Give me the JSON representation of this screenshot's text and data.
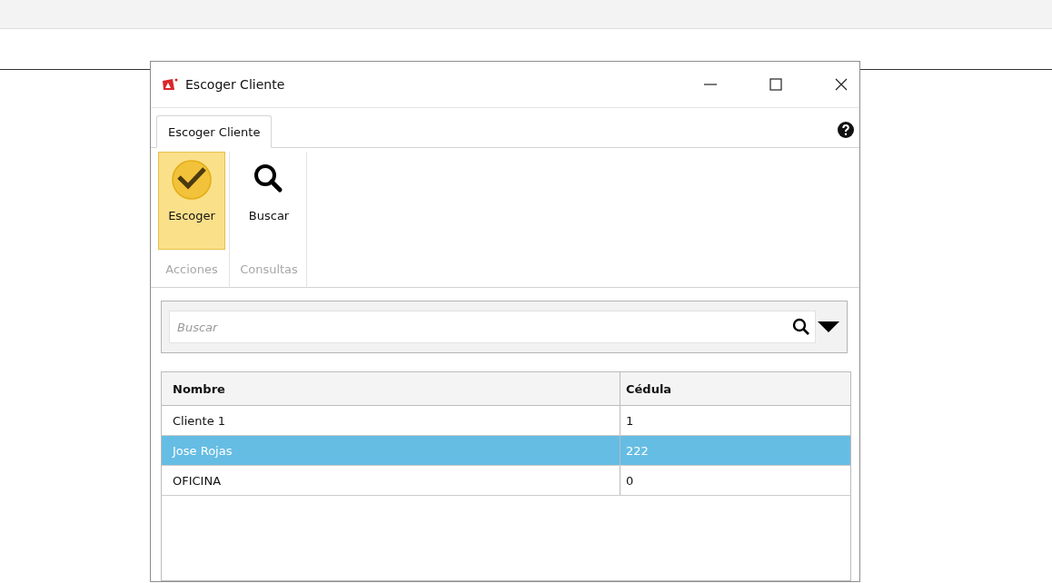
{
  "window": {
    "title": "Escoger Cliente"
  },
  "tabs": [
    {
      "label": "Escoger Cliente",
      "selected": true
    }
  ],
  "ribbon": {
    "groups": [
      {
        "label": "Acciones",
        "buttons": [
          {
            "label": "Escoger",
            "kind": "check",
            "highlighted": true
          }
        ]
      },
      {
        "label": "Consultas",
        "buttons": [
          {
            "label": "Buscar",
            "kind": "search",
            "highlighted": false
          }
        ]
      }
    ]
  },
  "search": {
    "placeholder": "Buscar"
  },
  "table": {
    "columns": [
      "Nombre",
      "Cédula"
    ],
    "rows": [
      {
        "cells": [
          "Cliente 1",
          "1"
        ],
        "selected": false
      },
      {
        "cells": [
          "Jose Rojas",
          "222"
        ],
        "selected": true
      },
      {
        "cells": [
          "OFICINA",
          "0"
        ],
        "selected": false
      }
    ]
  }
}
